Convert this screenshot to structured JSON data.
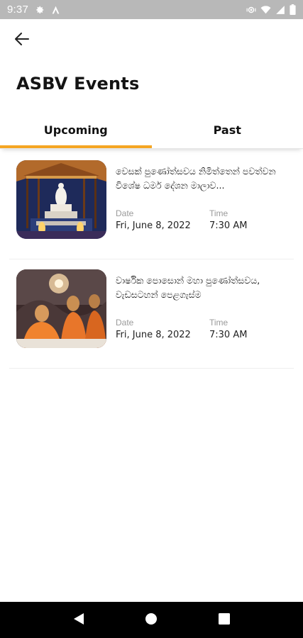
{
  "status_bar": {
    "time": "9:37",
    "icons": [
      "gear-icon",
      "a-logo-icon",
      "vibrate-icon",
      "wifi-icon",
      "signal-icon",
      "battery-icon"
    ]
  },
  "header": {
    "back_icon": "arrow-left-icon",
    "title": "ASBV Events"
  },
  "tabs": [
    {
      "label": "Upcoming",
      "active": true
    },
    {
      "label": "Past",
      "active": false
    }
  ],
  "accent_color": "#f5a623",
  "events": [
    {
      "title": "වෙසක් පුණෝත්සවය නිමිත්තෙන් පවත්වන විශේෂ ධර්ම දේශන මාලාව...",
      "date_label": "Date",
      "date": "Fri, June 8, 2022",
      "time_label": "Time",
      "time": "7:30 AM",
      "image": "buddha-statue-pavilion"
    },
    {
      "title": "වාර්ෂික පොසොන් මහා පුණෝත්සවය, වැඩසටහන් පෙළගැස්ම",
      "date_label": "Date",
      "date": "Fri, June 8, 2022",
      "time_label": "Time",
      "time": "7:30 AM",
      "image": "monks-meditating"
    }
  ],
  "nav_bar": {
    "icons": [
      "back-triangle-icon",
      "home-circle-icon",
      "recents-square-icon"
    ]
  }
}
